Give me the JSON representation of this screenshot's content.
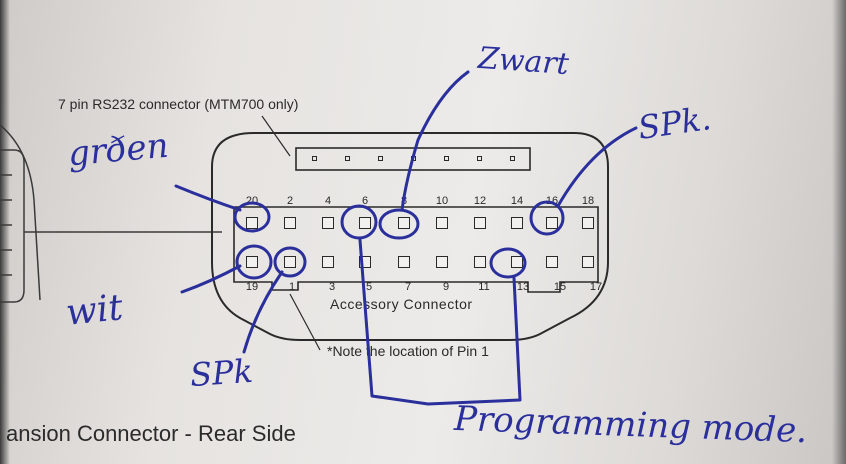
{
  "printed": {
    "rs232_label": "7 pin RS232 connector (MTM700 only)",
    "accessory_label": "Accessory Connector",
    "note": "*Note the location of Pin 1",
    "section_title": "ansion Connector - Rear Side"
  },
  "pins": {
    "top_row": [
      "20",
      "2",
      "4",
      "6",
      "8",
      "10",
      "12",
      "14",
      "16",
      "18"
    ],
    "bottom_row": [
      "19",
      "1",
      "3",
      "5",
      "7",
      "9",
      "11",
      "13",
      "15",
      "17"
    ]
  },
  "handwritten": {
    "green": "grðen",
    "zwart": "Zwart",
    "spk_right": "SPk.",
    "wit": "wit",
    "spk_left": "SPk",
    "programming": "Programming mode."
  },
  "colors": {
    "ink": "#2a2f9c",
    "print": "#2a2a2a",
    "paper": "#e6e3e0"
  }
}
